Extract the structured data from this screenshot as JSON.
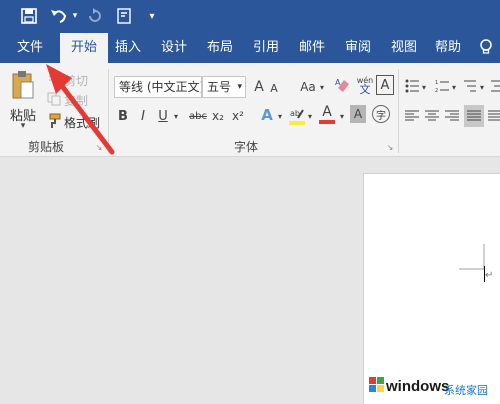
{
  "colors": {
    "title_bar": "#2b579a",
    "ribbon_bg": "#f3f3f3",
    "doc_bg": "#e6e6e6",
    "arrow": "#e53935",
    "font_color_red": "#e53935",
    "highlight_yellow": "#ffeb3b"
  },
  "tabs": [
    {
      "label": "文件"
    },
    {
      "label": "开始"
    },
    {
      "label": "插入"
    },
    {
      "label": "设计"
    },
    {
      "label": "布局"
    },
    {
      "label": "引用"
    },
    {
      "label": "邮件"
    },
    {
      "label": "审阅"
    },
    {
      "label": "视图"
    },
    {
      "label": "帮助"
    }
  ],
  "clipboard": {
    "paste_label": "粘贴",
    "cut_label": "剪切",
    "copy_label": "复制",
    "format_painter_label": "格式刷",
    "group_label": "剪贴板"
  },
  "font": {
    "font_name": "等线 (中文正文)",
    "font_size": "五号",
    "grow": "A",
    "shrink": "A",
    "case": "Aa",
    "phonetic": "wén",
    "bold": "B",
    "italic": "I",
    "underline": "U",
    "strike": "abc",
    "subscript": "x₂",
    "superscript": "x²",
    "font_color": "A",
    "char_shade": "A",
    "group_label": "字体"
  },
  "paragraph": {
    "paragraph_mark": "↵"
  },
  "watermark": {
    "brand": "windows",
    "suffix": "系统家园"
  }
}
